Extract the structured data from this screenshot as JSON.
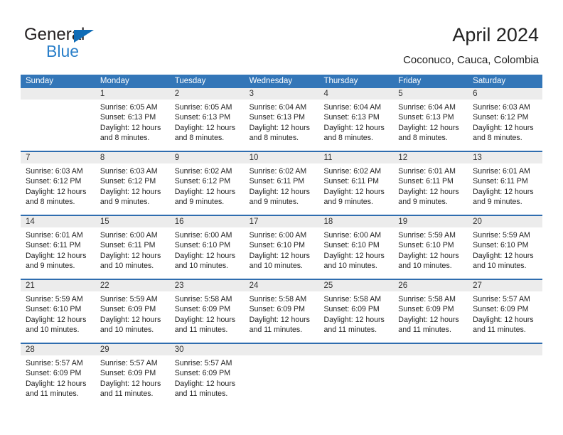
{
  "brand": {
    "name_top": "General",
    "name_bottom": "Blue",
    "accent_color": "#2a7fc9",
    "triangle_color": "#0f6cb6"
  },
  "header": {
    "title": "April 2024",
    "subtitle": "Coconuco, Cauca, Colombia"
  },
  "calendar": {
    "header_bg": "#3376b8",
    "row_separator_color": "#2f6daf",
    "day_band_bg": "#ececec",
    "weekdays": [
      "Sunday",
      "Monday",
      "Tuesday",
      "Wednesday",
      "Thursday",
      "Friday",
      "Saturday"
    ],
    "weeks": [
      [
        {
          "day": "",
          "lines": []
        },
        {
          "day": "1",
          "lines": [
            "Sunrise: 6:05 AM",
            "Sunset: 6:13 PM",
            "Daylight: 12 hours",
            "and 8 minutes."
          ]
        },
        {
          "day": "2",
          "lines": [
            "Sunrise: 6:05 AM",
            "Sunset: 6:13 PM",
            "Daylight: 12 hours",
            "and 8 minutes."
          ]
        },
        {
          "day": "3",
          "lines": [
            "Sunrise: 6:04 AM",
            "Sunset: 6:13 PM",
            "Daylight: 12 hours",
            "and 8 minutes."
          ]
        },
        {
          "day": "4",
          "lines": [
            "Sunrise: 6:04 AM",
            "Sunset: 6:13 PM",
            "Daylight: 12 hours",
            "and 8 minutes."
          ]
        },
        {
          "day": "5",
          "lines": [
            "Sunrise: 6:04 AM",
            "Sunset: 6:13 PM",
            "Daylight: 12 hours",
            "and 8 minutes."
          ]
        },
        {
          "day": "6",
          "lines": [
            "Sunrise: 6:03 AM",
            "Sunset: 6:12 PM",
            "Daylight: 12 hours",
            "and 8 minutes."
          ]
        }
      ],
      [
        {
          "day": "7",
          "lines": [
            "Sunrise: 6:03 AM",
            "Sunset: 6:12 PM",
            "Daylight: 12 hours",
            "and 8 minutes."
          ]
        },
        {
          "day": "8",
          "lines": [
            "Sunrise: 6:03 AM",
            "Sunset: 6:12 PM",
            "Daylight: 12 hours",
            "and 9 minutes."
          ]
        },
        {
          "day": "9",
          "lines": [
            "Sunrise: 6:02 AM",
            "Sunset: 6:12 PM",
            "Daylight: 12 hours",
            "and 9 minutes."
          ]
        },
        {
          "day": "10",
          "lines": [
            "Sunrise: 6:02 AM",
            "Sunset: 6:11 PM",
            "Daylight: 12 hours",
            "and 9 minutes."
          ]
        },
        {
          "day": "11",
          "lines": [
            "Sunrise: 6:02 AM",
            "Sunset: 6:11 PM",
            "Daylight: 12 hours",
            "and 9 minutes."
          ]
        },
        {
          "day": "12",
          "lines": [
            "Sunrise: 6:01 AM",
            "Sunset: 6:11 PM",
            "Daylight: 12 hours",
            "and 9 minutes."
          ]
        },
        {
          "day": "13",
          "lines": [
            "Sunrise: 6:01 AM",
            "Sunset: 6:11 PM",
            "Daylight: 12 hours",
            "and 9 minutes."
          ]
        }
      ],
      [
        {
          "day": "14",
          "lines": [
            "Sunrise: 6:01 AM",
            "Sunset: 6:11 PM",
            "Daylight: 12 hours",
            "and 9 minutes."
          ]
        },
        {
          "day": "15",
          "lines": [
            "Sunrise: 6:00 AM",
            "Sunset: 6:11 PM",
            "Daylight: 12 hours",
            "and 10 minutes."
          ]
        },
        {
          "day": "16",
          "lines": [
            "Sunrise: 6:00 AM",
            "Sunset: 6:10 PM",
            "Daylight: 12 hours",
            "and 10 minutes."
          ]
        },
        {
          "day": "17",
          "lines": [
            "Sunrise: 6:00 AM",
            "Sunset: 6:10 PM",
            "Daylight: 12 hours",
            "and 10 minutes."
          ]
        },
        {
          "day": "18",
          "lines": [
            "Sunrise: 6:00 AM",
            "Sunset: 6:10 PM",
            "Daylight: 12 hours",
            "and 10 minutes."
          ]
        },
        {
          "day": "19",
          "lines": [
            "Sunrise: 5:59 AM",
            "Sunset: 6:10 PM",
            "Daylight: 12 hours",
            "and 10 minutes."
          ]
        },
        {
          "day": "20",
          "lines": [
            "Sunrise: 5:59 AM",
            "Sunset: 6:10 PM",
            "Daylight: 12 hours",
            "and 10 minutes."
          ]
        }
      ],
      [
        {
          "day": "21",
          "lines": [
            "Sunrise: 5:59 AM",
            "Sunset: 6:10 PM",
            "Daylight: 12 hours",
            "and 10 minutes."
          ]
        },
        {
          "day": "22",
          "lines": [
            "Sunrise: 5:59 AM",
            "Sunset: 6:09 PM",
            "Daylight: 12 hours",
            "and 10 minutes."
          ]
        },
        {
          "day": "23",
          "lines": [
            "Sunrise: 5:58 AM",
            "Sunset: 6:09 PM",
            "Daylight: 12 hours",
            "and 11 minutes."
          ]
        },
        {
          "day": "24",
          "lines": [
            "Sunrise: 5:58 AM",
            "Sunset: 6:09 PM",
            "Daylight: 12 hours",
            "and 11 minutes."
          ]
        },
        {
          "day": "25",
          "lines": [
            "Sunrise: 5:58 AM",
            "Sunset: 6:09 PM",
            "Daylight: 12 hours",
            "and 11 minutes."
          ]
        },
        {
          "day": "26",
          "lines": [
            "Sunrise: 5:58 AM",
            "Sunset: 6:09 PM",
            "Daylight: 12 hours",
            "and 11 minutes."
          ]
        },
        {
          "day": "27",
          "lines": [
            "Sunrise: 5:57 AM",
            "Sunset: 6:09 PM",
            "Daylight: 12 hours",
            "and 11 minutes."
          ]
        }
      ],
      [
        {
          "day": "28",
          "lines": [
            "Sunrise: 5:57 AM",
            "Sunset: 6:09 PM",
            "Daylight: 12 hours",
            "and 11 minutes."
          ]
        },
        {
          "day": "29",
          "lines": [
            "Sunrise: 5:57 AM",
            "Sunset: 6:09 PM",
            "Daylight: 12 hours",
            "and 11 minutes."
          ]
        },
        {
          "day": "30",
          "lines": [
            "Sunrise: 5:57 AM",
            "Sunset: 6:09 PM",
            "Daylight: 12 hours",
            "and 11 minutes."
          ]
        },
        {
          "day": "",
          "lines": []
        },
        {
          "day": "",
          "lines": []
        },
        {
          "day": "",
          "lines": []
        },
        {
          "day": "",
          "lines": []
        }
      ]
    ]
  }
}
